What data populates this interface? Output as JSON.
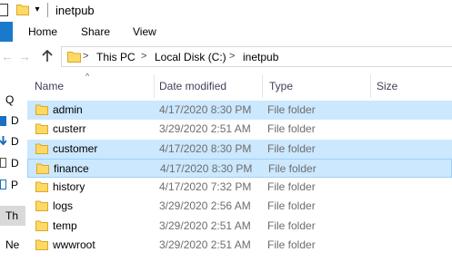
{
  "window": {
    "title": "inetpub"
  },
  "ribbon": {
    "tabs": [
      "Home",
      "Share",
      "View"
    ]
  },
  "address": {
    "crumbs": [
      "This PC",
      "Local Disk (C:)",
      "inetpub"
    ]
  },
  "navpane": {
    "items": [
      "Q",
      "D",
      "D",
      "D",
      "P",
      "Th",
      "Ne"
    ]
  },
  "columns": {
    "name": "Name",
    "date": "Date modified",
    "type": "Type",
    "size": "Size"
  },
  "files": [
    {
      "name": "admin",
      "date": "4/17/2020 8:30 PM",
      "type": "File folder",
      "state": "selected"
    },
    {
      "name": "custerr",
      "date": "3/29/2020 2:51 AM",
      "type": "File folder",
      "state": ""
    },
    {
      "name": "customer",
      "date": "4/17/2020 8:30 PM",
      "type": "File folder",
      "state": "selected"
    },
    {
      "name": "finance",
      "date": "4/17/2020 8:30 PM",
      "type": "File folder",
      "state": "focused"
    },
    {
      "name": "history",
      "date": "4/17/2020 7:32 PM",
      "type": "File folder",
      "state": ""
    },
    {
      "name": "logs",
      "date": "3/29/2020 2:56 AM",
      "type": "File folder",
      "state": ""
    },
    {
      "name": "temp",
      "date": "3/29/2020 2:51 AM",
      "type": "File folder",
      "state": ""
    },
    {
      "name": "wwwroot",
      "date": "3/29/2020 2:51 AM",
      "type": "File folder",
      "state": ""
    }
  ],
  "colors": {
    "selection": "#cce8ff",
    "focus_border": "#99d1ff",
    "folder_yellow": "#ffd966",
    "ribbon_blue": "#1979ca"
  },
  "icons": [
    "quick-access-checkbox-icon",
    "folder-icon",
    "dropdown-icon",
    "back-icon",
    "forward-icon",
    "up-arrow-icon",
    "chevron-right-icon",
    "sort-caret-icon"
  ]
}
